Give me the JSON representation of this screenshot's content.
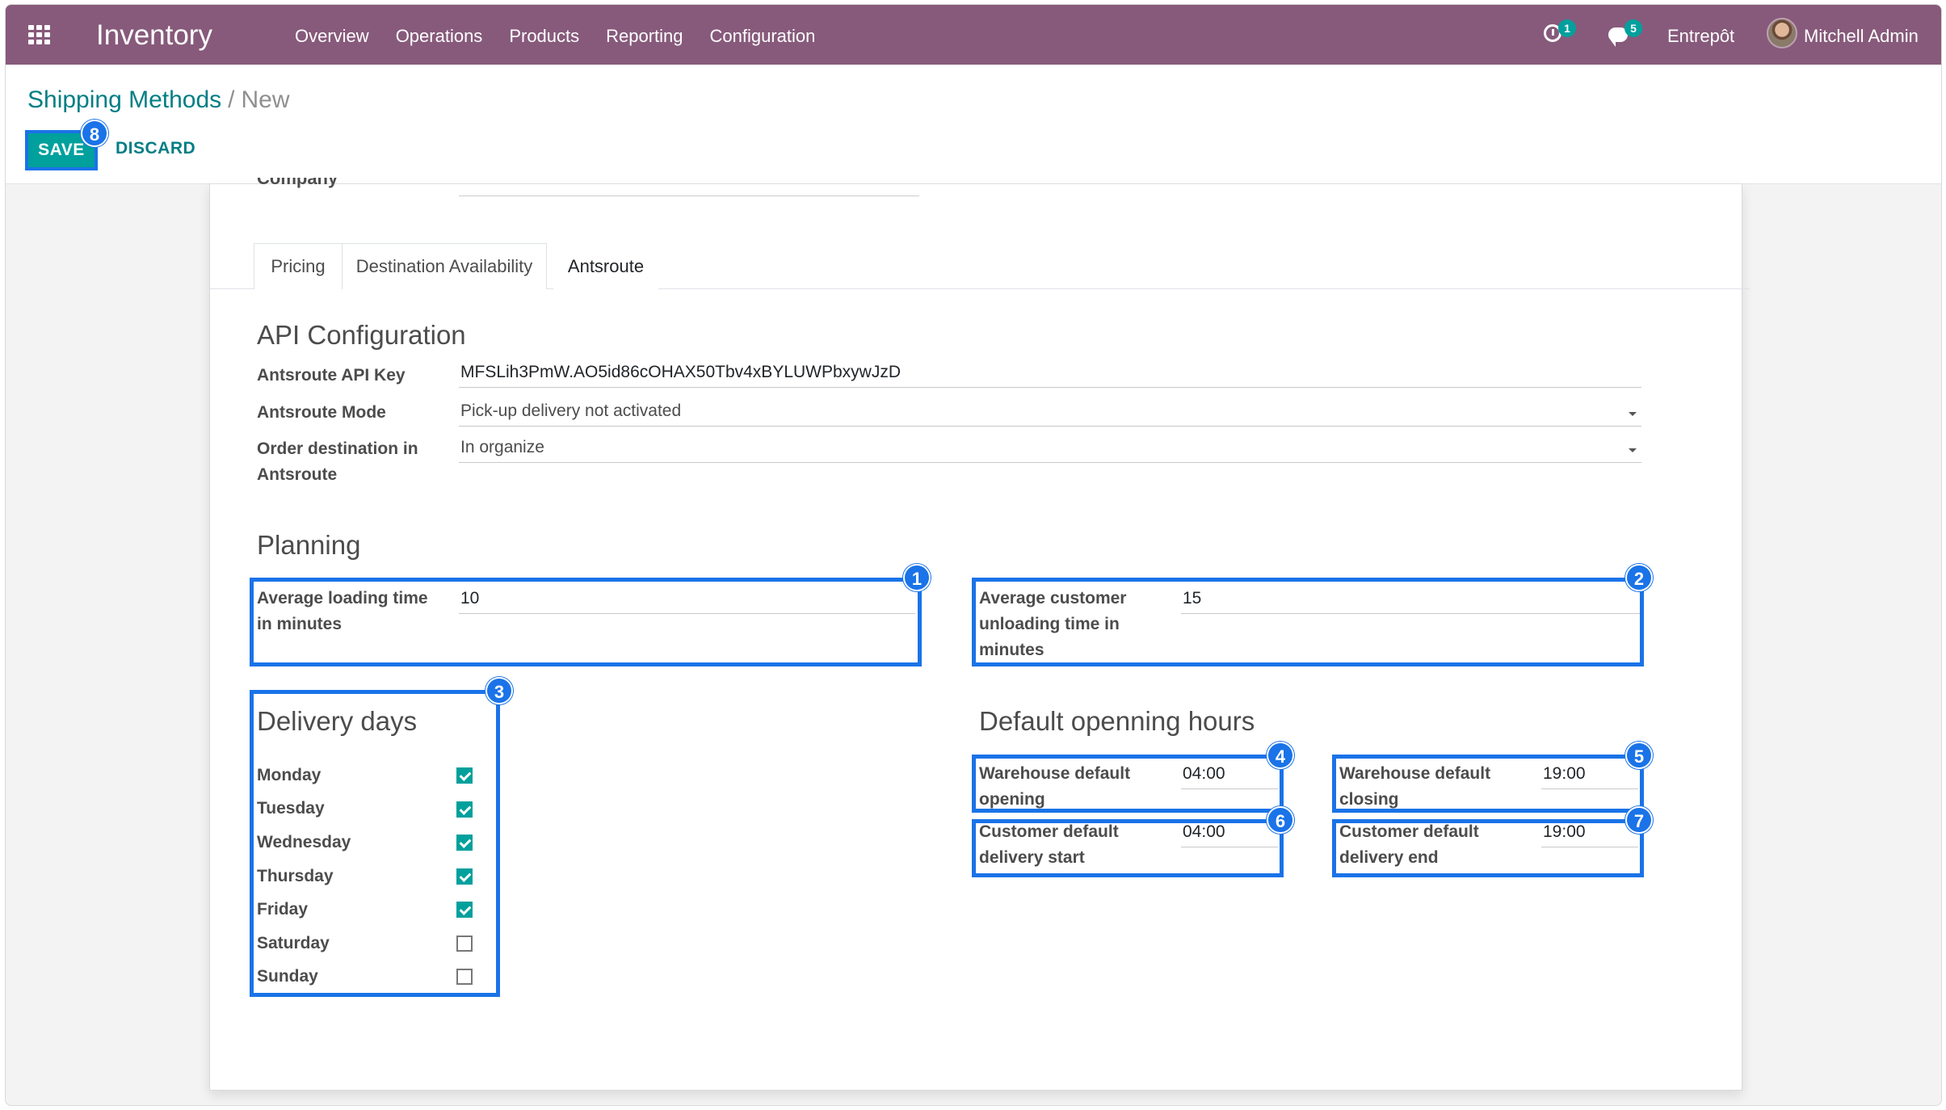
{
  "navbar": {
    "app_title": "Inventory",
    "menu": [
      "Overview",
      "Operations",
      "Products",
      "Reporting",
      "Configuration"
    ],
    "activity_count": "1",
    "message_count": "5",
    "company": "Entrepôt",
    "user": "Mitchell Admin"
  },
  "breadcrumb": {
    "parent": "Shipping Methods",
    "separator": "/",
    "current": "New"
  },
  "buttons": {
    "save": "SAVE",
    "discard": "DISCARD"
  },
  "form": {
    "partial_label": "Company",
    "tabs": [
      "Pricing",
      "Destination Availability",
      "Antsroute"
    ],
    "active_tab": "Antsroute",
    "api": {
      "title": "API Configuration",
      "key_label": "Antsroute API Key",
      "key_value": "MFSLih3PmW.AO5id86cOHAX50Tbv4xBYLUWPbxywJzD",
      "mode_label": "Antsroute Mode",
      "mode_value": "Pick-up delivery not activated",
      "order_label_1": "Order destination in",
      "order_label_2": "Antsroute",
      "order_value": "In organize"
    },
    "planning": {
      "title": "Planning",
      "loading_label_1": "Average loading time",
      "loading_label_2": "in minutes",
      "loading_value": "10",
      "unloading_label_1": "Average customer",
      "unloading_label_2": "unloading time in",
      "unloading_label_3": "minutes",
      "unloading_value": "15"
    },
    "delivery_days": {
      "title": "Delivery days",
      "days": [
        {
          "label": "Monday",
          "checked": true
        },
        {
          "label": "Tuesday",
          "checked": true
        },
        {
          "label": "Wednesday",
          "checked": true
        },
        {
          "label": "Thursday",
          "checked": true
        },
        {
          "label": "Friday",
          "checked": true
        },
        {
          "label": "Saturday",
          "checked": false
        },
        {
          "label": "Sunday",
          "checked": false
        }
      ]
    },
    "hours": {
      "title": "Default openning hours",
      "wh_open_label_1": "Warehouse default",
      "wh_open_label_2": "opening",
      "wh_open_value": "04:00",
      "wh_close_label_1": "Warehouse default",
      "wh_close_label_2": "closing",
      "wh_close_value": "19:00",
      "cust_start_label_1": "Customer default",
      "cust_start_label_2": "delivery start",
      "cust_start_value": "04:00",
      "cust_end_label_1": "Customer default",
      "cust_end_label_2": "delivery end",
      "cust_end_value": "19:00"
    }
  },
  "markers": [
    "1",
    "2",
    "3",
    "4",
    "5",
    "6",
    "7",
    "8"
  ],
  "colors": {
    "navbar": "#875a7b",
    "accent": "#00a09d",
    "link": "#017e84",
    "highlight": "#1a73e8"
  }
}
